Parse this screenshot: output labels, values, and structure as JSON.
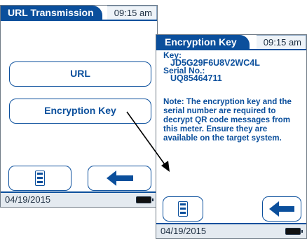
{
  "screen1": {
    "title": "URL Transmission",
    "time": "09:15 am",
    "buttons": {
      "url": "URL",
      "encryption_key": "Encryption Key"
    },
    "date": "04/19/2015"
  },
  "screen2": {
    "title": "Encryption Key",
    "time": "09:15 am",
    "key_label": "Key:",
    "key_value": "JD5G29F6U8V2WC4L",
    "serial_label": "Serial No.:",
    "serial_value": "UQ85464711",
    "note": "Note: The encryption key and the serial number are required to decrypt QR code messages from this meter. Ensure they are available on the target system.",
    "date": "04/19/2015"
  },
  "icons": [
    "menu-icon",
    "back-arrow-icon",
    "battery-icon"
  ],
  "colors": {
    "primary": "#0b4f9c",
    "footer": "#e4eaf0"
  }
}
